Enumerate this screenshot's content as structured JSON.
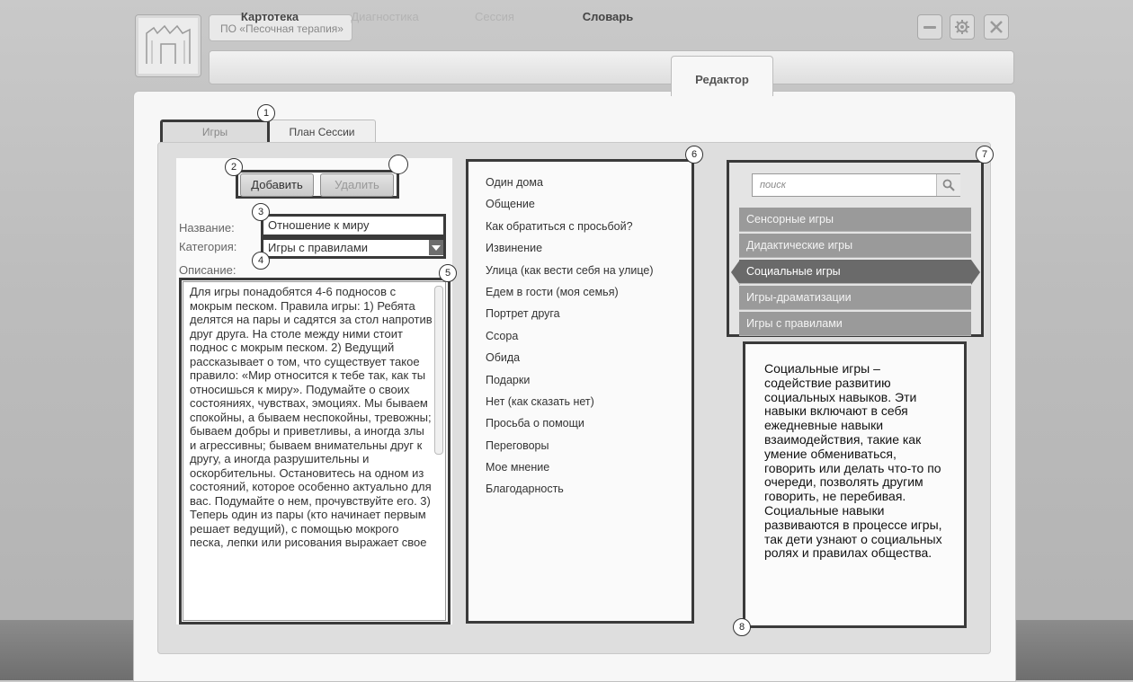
{
  "app": {
    "title": "ПО «Песочная терапия»",
    "window_controls": [
      {
        "name": "minimize-icon"
      },
      {
        "name": "settings-gear-icon"
      },
      {
        "name": "close-icon"
      }
    ]
  },
  "nav": {
    "tabs": [
      {
        "label": "Картотека",
        "enabled": true
      },
      {
        "label": "Диагностика",
        "enabled": false
      },
      {
        "label": "Сессия",
        "enabled": false
      },
      {
        "label": "Словарь",
        "enabled": true
      },
      {
        "label": "Редактор",
        "active": true
      }
    ]
  },
  "subtabs": {
    "games": "Игры",
    "session_plan": "План Сессии"
  },
  "editor": {
    "add_label": "Добавить",
    "delete_label": "Удалить",
    "name_label": "Название:",
    "name_value": "Отношение к миру",
    "category_label": "Категория:",
    "category_value": "Игры с правилами",
    "description_label": "Описание:",
    "description_text": "Для игры понадобятся 4-6 подносов с мокрым песком. Правила игры: 1) Ребята делятся на пары и садятся за стол напротив друг друга. На столе между ними стоит поднос с мокрым песком. 2) Ведущий рассказывает о том, что существует такое правило: «Мир относится к тебе так, как ты относишься к миру». Подумайте о своих состояниях, чувствах, эмоциях. Мы бываем спокойны, а бываем неспокойны, тревожны; бываем добры и приветливы, а иногда злы и агрессивны; бываем внимательны друг к другу, а иногда разрушительны и оскорбительны. Остановитесь на одном из состояний, которое особенно актуально для вас. Подумайте о нем, прочувствуйте его. 3) Теперь один из пары (кто начинает первым решает ведущий), с помощью мокрого песка, лепки или рисования выражает свое"
  },
  "games": [
    "Один дома",
    "Общение",
    "Как обратиться с просьбой?",
    "Извинение",
    "Улица (как вести себя на улице)",
    "Едем в гости (моя семья)",
    "Портрет друга",
    "Ссора",
    "Обида",
    "Подарки",
    "Нет (как сказать нет)",
    "Просьба о помощи",
    "Переговоры",
    "Мое мнение",
    "Благодарность"
  ],
  "categories": {
    "search_placeholder": "поиск",
    "items": [
      {
        "label": "Сенсорные игры"
      },
      {
        "label": "Дидактические игры"
      },
      {
        "label": "Социальные игры",
        "active": true
      },
      {
        "label": "Игры-драматизации"
      },
      {
        "label": "Игры с правилами"
      }
    ],
    "info_text": "Социальные игры – содействие развитию социальных навыков. Эти навыки включают в себя ежедневные навыки взаимодействия, такие как умение обмениваться, говорить или делать что-то по очереди, позволять другим говорить, не перебивая. Социальные навыки развиваются в процессе игры, так дети узнают о социальных ролях и правилах общества."
  },
  "markers": [
    "1",
    "2",
    "3",
    "4",
    "5",
    "6",
    "7",
    "8"
  ],
  "colors": {
    "callout_border": "#3a3a3a",
    "category_item": "#9a9a9a",
    "category_active": "#6a6a6a"
  }
}
